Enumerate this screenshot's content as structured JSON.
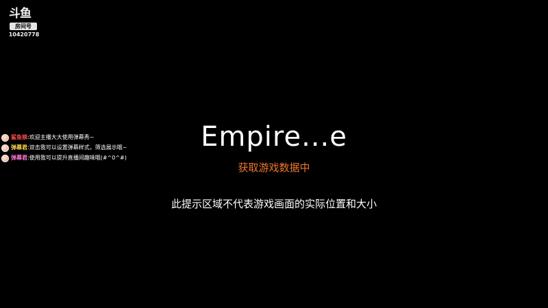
{
  "logo": {
    "mark": "斗鱼",
    "room_label": "房间号",
    "room_number": "10420778"
  },
  "danmaku": [
    {
      "user": "鲨鱼娘",
      "user_color": "#ff4b4b",
      "separator": ":",
      "text": "欢迎主播大大使用弹幕秀~"
    },
    {
      "user": "弹幕君",
      "user_color": "#ffd84a",
      "separator": ":",
      "text": "双击我可以设置弹幕样式，筛选展示哦~"
    },
    {
      "user": "弹幕君",
      "user_color": "#ff7ad9",
      "separator": ":",
      "text": "使用我可以提升直播间趣味哦(#^0^#)"
    }
  ],
  "main": {
    "game_title": "Empire...e",
    "loading_status": "获取游戏数据中",
    "hint": "此提示区域不代表游戏画面的实际位置和大小"
  },
  "colors": {
    "background": "#000000",
    "status_orange": "#f0782a"
  }
}
